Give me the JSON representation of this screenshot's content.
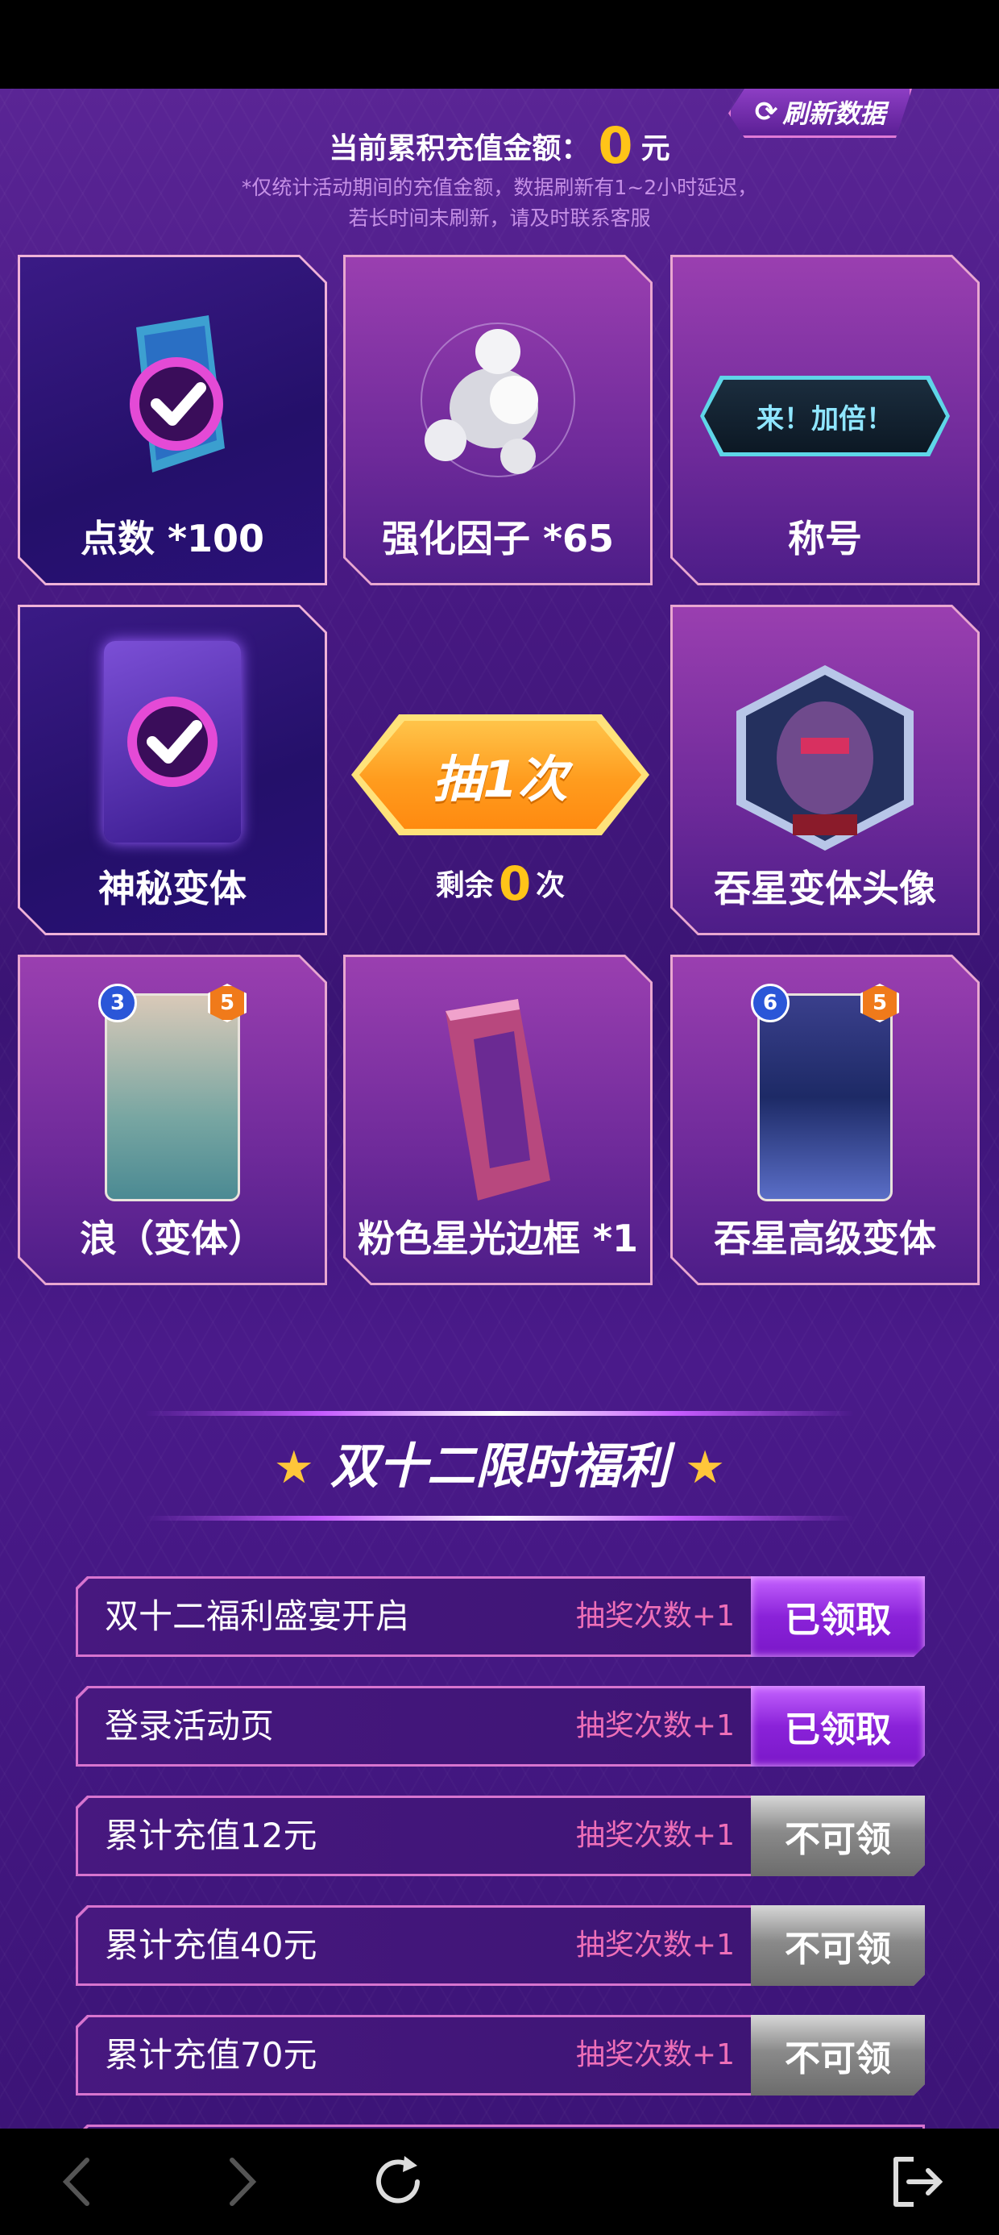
{
  "header": {
    "total_label": "当前累积充值金额：",
    "total_amount": "0",
    "total_unit": "元",
    "refresh_button": "刷新数据",
    "note_line1": "*仅统计活动期间的充值金额，数据刷新有1~2小时延迟，",
    "note_line2": "若长时间未刷新，请及时联系客服"
  },
  "prizes": [
    {
      "label": "点数 *100",
      "icon": "check-crystal-icon"
    },
    {
      "label": "强化因子 *65",
      "icon": "pearl-cluster-icon"
    },
    {
      "label": "称号",
      "icon": "title-badge-icon",
      "badge_text": "来！加倍！"
    },
    {
      "label": "神秘变体",
      "icon": "mystery-card-icon"
    },
    {
      "label": "吞星变体头像",
      "icon": "galactus-avatar-icon"
    },
    {
      "label": "浪（变体）",
      "icon": "wave-card-icon",
      "cost": "3",
      "power": "5"
    },
    {
      "label": "粉色星光边框 *1",
      "icon": "pink-frame-icon"
    },
    {
      "label": "吞星高级变体",
      "icon": "galactus-card-icon",
      "cost": "6",
      "power": "5"
    }
  ],
  "draw": {
    "button_label": "抽1次",
    "remaining_prefix": "剩余",
    "remaining_count": "0",
    "remaining_suffix": "次"
  },
  "section": {
    "title": "双十二限时福利"
  },
  "tasks": [
    {
      "name": "双十二福利盛宴开启",
      "reward": "抽奖次数+1",
      "button": "已领取",
      "state": "claimed"
    },
    {
      "name": "登录活动页",
      "reward": "抽奖次数+1",
      "button": "已领取",
      "state": "claimed"
    },
    {
      "name": "累计充值12元",
      "reward": "抽奖次数+1",
      "button": "不可领",
      "state": "disabled"
    },
    {
      "name": "累计充值40元",
      "reward": "抽奖次数+1",
      "button": "不可领",
      "state": "disabled"
    },
    {
      "name": "累计充值70元",
      "reward": "抽奖次数+1",
      "button": "不可领",
      "state": "disabled"
    }
  ],
  "colors": {
    "accent_gold": "#ffc418",
    "reward_pink": "#ef6fb8",
    "background_purple": "#4a1a85"
  },
  "nav_icons": [
    "back-icon",
    "forward-icon",
    "reload-icon",
    "exit-icon"
  ]
}
